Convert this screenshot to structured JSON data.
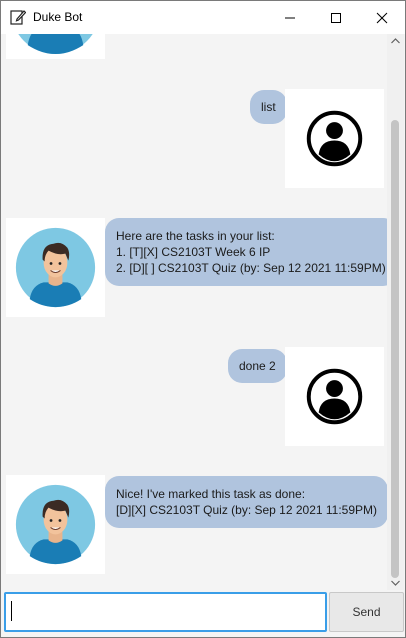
{
  "window": {
    "title": "Duke Bot"
  },
  "messages": [
    {
      "sender": "duke",
      "lines": []
    },
    {
      "sender": "user",
      "text": "list"
    },
    {
      "sender": "duke",
      "lines": [
        "Here are the tasks in your list:",
        "1. [T][X] CS2103T Week 6 IP",
        "2. [D][ ] CS2103T Quiz (by: Sep 12 2021 11:59PM)"
      ]
    },
    {
      "sender": "user",
      "text": "done 2"
    },
    {
      "sender": "duke",
      "lines": [
        "Nice! I've marked this task as done:",
        "[D][X] CS2103T Quiz (by: Sep 12 2021 11:59PM)"
      ]
    }
  ],
  "input": {
    "value": "",
    "placeholder": ""
  },
  "send_button": {
    "label": "Send"
  },
  "colors": {
    "bubble": "#b0c4de",
    "avatar_bg": "#7ec8e3",
    "shirt": "#1a7db5",
    "focus": "#3a9ee8"
  }
}
